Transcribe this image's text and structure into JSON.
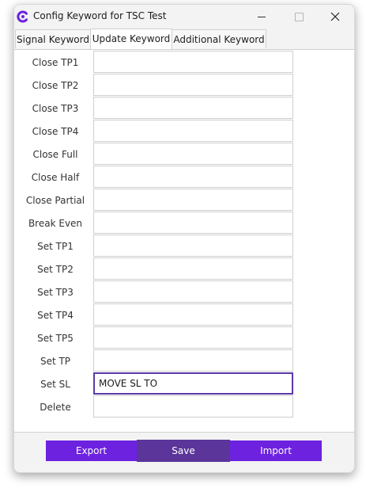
{
  "window": {
    "title": "Config Keyword for TSC Test",
    "accent_color": "#6d22e0"
  },
  "tabs": [
    {
      "label": "Signal Keyword",
      "active": false
    },
    {
      "label": "Update Keyword",
      "active": true
    },
    {
      "label": "Additional Keyword",
      "active": false
    }
  ],
  "fields": [
    {
      "label": "Close TP1",
      "value": ""
    },
    {
      "label": "Close TP2",
      "value": ""
    },
    {
      "label": "Close TP3",
      "value": ""
    },
    {
      "label": "Close TP4",
      "value": ""
    },
    {
      "label": "Close Full",
      "value": ""
    },
    {
      "label": "Close Half",
      "value": ""
    },
    {
      "label": "Close Partial",
      "value": ""
    },
    {
      "label": "Break Even",
      "value": ""
    },
    {
      "label": "Set TP1",
      "value": ""
    },
    {
      "label": "Set TP2",
      "value": ""
    },
    {
      "label": "Set TP3",
      "value": ""
    },
    {
      "label": "Set TP4",
      "value": ""
    },
    {
      "label": "Set TP5",
      "value": ""
    },
    {
      "label": "Set TP",
      "value": ""
    },
    {
      "label": "Set SL",
      "value": "MOVE SL TO",
      "focused": true
    },
    {
      "label": "Delete",
      "value": ""
    }
  ],
  "buttons": {
    "export": "Export",
    "save": "Save",
    "import": "Import"
  }
}
